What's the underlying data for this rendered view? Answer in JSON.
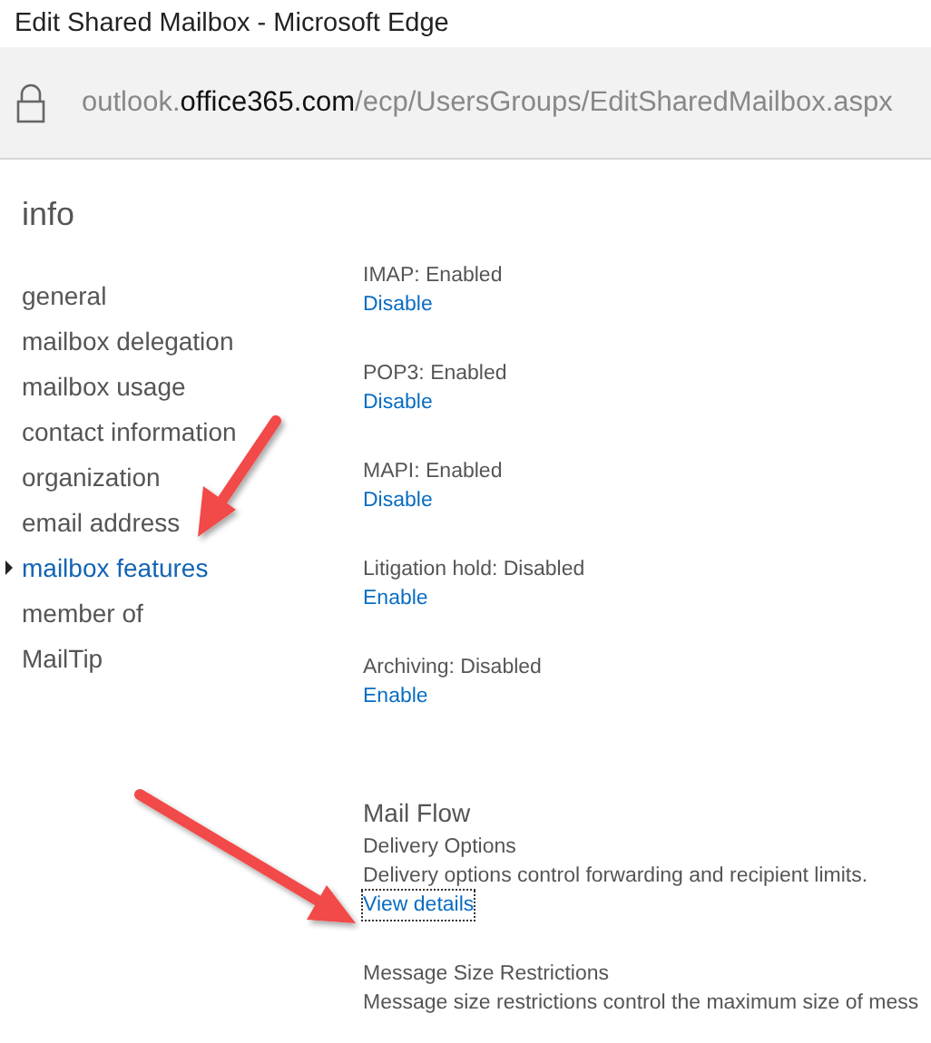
{
  "window": {
    "title": "Edit Shared Mailbox - Microsoft Edge"
  },
  "address_bar": {
    "url_prefix": "outlook.",
    "url_domain": "office365.com",
    "url_path": "/ecp/UsersGroups/EditSharedMailbox.aspx"
  },
  "page": {
    "title": "info"
  },
  "sidebar": {
    "items": [
      {
        "label": "general",
        "selected": false
      },
      {
        "label": "mailbox delegation",
        "selected": false
      },
      {
        "label": "mailbox usage",
        "selected": false
      },
      {
        "label": "contact information",
        "selected": false
      },
      {
        "label": "organization",
        "selected": false
      },
      {
        "label": "email address",
        "selected": false
      },
      {
        "label": "mailbox features",
        "selected": true
      },
      {
        "label": "member of",
        "selected": false
      },
      {
        "label": "MailTip",
        "selected": false
      }
    ]
  },
  "features": [
    {
      "status": "IMAP: Enabled",
      "action": "Disable"
    },
    {
      "status": "POP3: Enabled",
      "action": "Disable"
    },
    {
      "status": "MAPI: Enabled",
      "action": "Disable"
    },
    {
      "status": "Litigation hold: Disabled",
      "action": "Enable"
    },
    {
      "status": "Archiving: Disabled",
      "action": "Enable"
    }
  ],
  "mail_flow": {
    "heading": "Mail Flow",
    "sections": [
      {
        "title": "Delivery Options",
        "description": "Delivery options control forwarding and recipient limits.",
        "link": "View details",
        "focused": true
      },
      {
        "title": "Message Size Restrictions",
        "description": "Message size restrictions control the maximum size of mess"
      }
    ]
  }
}
